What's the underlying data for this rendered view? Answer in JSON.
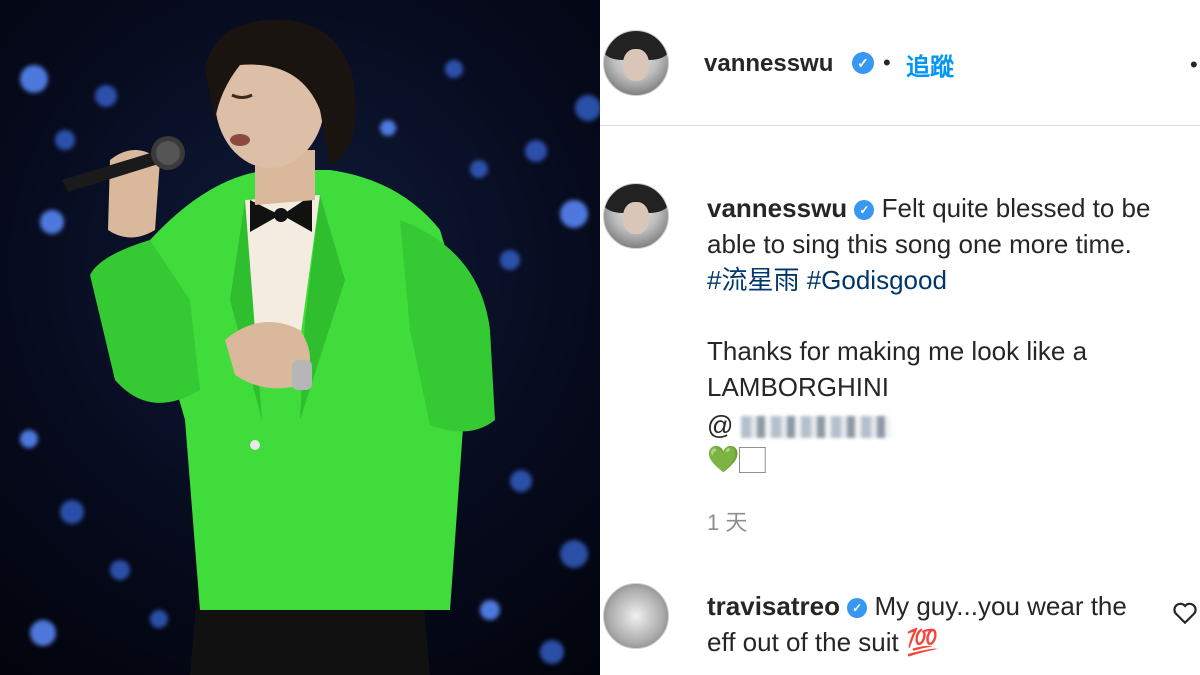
{
  "post": {
    "author": "vannesswu",
    "follow_label": "追蹤",
    "separator": "•",
    "caption_text": "Felt quite blessed to be able to sing this song one more time.",
    "hashtags": [
      "#流星雨",
      "#Godisgood"
    ],
    "thanks_line1": "Thanks for making me look like a",
    "thanks_line2": "LAMBORGHINI",
    "mention_prefix": "@",
    "emoji_line": "💚🏻",
    "time_ago": "1 天"
  },
  "comment": {
    "author": "travisatreo",
    "text": "My guy...you wear the eff out of the suit 💯"
  },
  "icons": {
    "verified": "verified-badge-icon",
    "like": "heart-outline-icon",
    "more": "more-options-icon"
  },
  "colors": {
    "link": "#0095f6",
    "hashtag": "#00376b",
    "text": "#262626",
    "muted": "#8e8e8e",
    "suit_green": "#3fdc3c"
  }
}
